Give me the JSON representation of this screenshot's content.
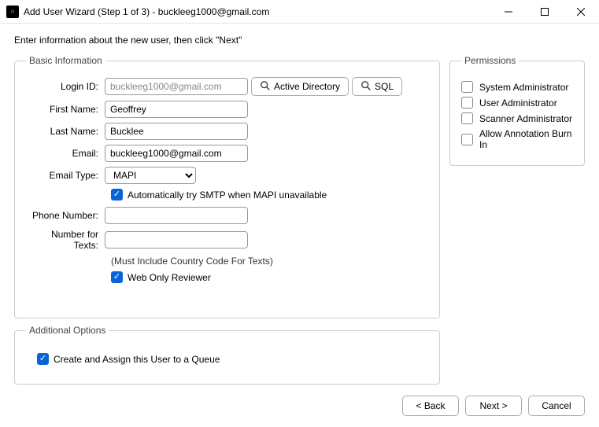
{
  "window": {
    "title": "Add User Wizard (Step 1 of 3) - buckleeg1000@gmail.com"
  },
  "instructions": "Enter information about the new user, then click \"Next\"",
  "basic": {
    "legend": "Basic Information",
    "labels": {
      "login": "Login ID:",
      "first": "First Name:",
      "last": "Last Name:",
      "email": "Email:",
      "emailType": "Email Type:",
      "phone": "Phone Number:",
      "texts": "Number for Texts:"
    },
    "values": {
      "login": "buckleeg1000@gmail.com",
      "first": "Geoffrey",
      "last": "Bucklee",
      "email": "buckleeg1000@gmail.com",
      "emailType": "MAPI",
      "phone": "",
      "texts": ""
    },
    "buttons": {
      "ad": "Active Directory",
      "sql": "SQL"
    },
    "checks": {
      "smtp": {
        "label": "Automatically try SMTP when MAPI unavailable",
        "checked": true
      },
      "webonly": {
        "label": "Web Only Reviewer",
        "checked": true
      }
    },
    "textsHint": "(Must Include Country Code For Texts)"
  },
  "permissions": {
    "legend": "Permissions",
    "items": [
      {
        "label": "System Administrator",
        "checked": false
      },
      {
        "label": "User Administrator",
        "checked": false
      },
      {
        "label": "Scanner Administrator",
        "checked": false
      },
      {
        "label": "Allow Annotation Burn In",
        "checked": false
      }
    ]
  },
  "additional": {
    "legend": "Additional Options",
    "queue": {
      "label": "Create and Assign this User to a Queue",
      "checked": true
    }
  },
  "footer": {
    "back": "< Back",
    "next": "Next >",
    "cancel": "Cancel"
  }
}
